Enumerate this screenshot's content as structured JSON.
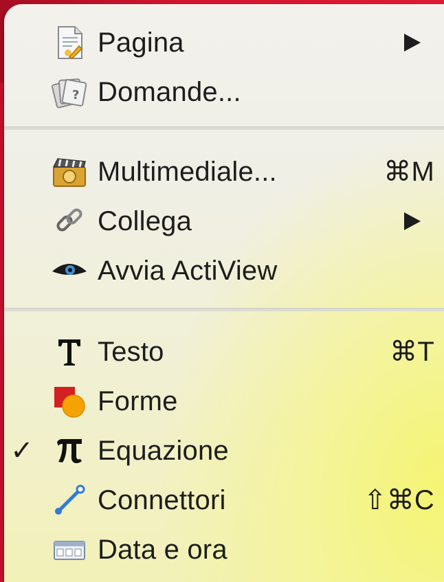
{
  "menu": {
    "items": [
      {
        "label": "Pagina",
        "icon": "page-icon",
        "submenu": true
      },
      {
        "label": "Domande...",
        "icon": "questions-icon"
      },
      {
        "label": "Multimediale...",
        "icon": "multimedia-icon",
        "shortcut": "⌘M"
      },
      {
        "label": "Collega",
        "icon": "link-icon",
        "submenu": true
      },
      {
        "label": "Avvia ActiView",
        "icon": "eye-icon"
      },
      {
        "label": "Testo",
        "icon": "text-icon",
        "shortcut": "⌘T"
      },
      {
        "label": "Forme",
        "icon": "shapes-icon"
      },
      {
        "label": "Equazione",
        "icon": "pi-icon",
        "checked": true,
        "check_mark": "✓"
      },
      {
        "label": "Connettori",
        "icon": "connector-icon",
        "shortcut": "⇧⌘C"
      },
      {
        "label": "Data e ora",
        "icon": "calendar-icon"
      }
    ]
  },
  "colors": {
    "backdrop": "#c8102e",
    "text": "#1d1d1d",
    "separator": "#dcdbd2"
  }
}
